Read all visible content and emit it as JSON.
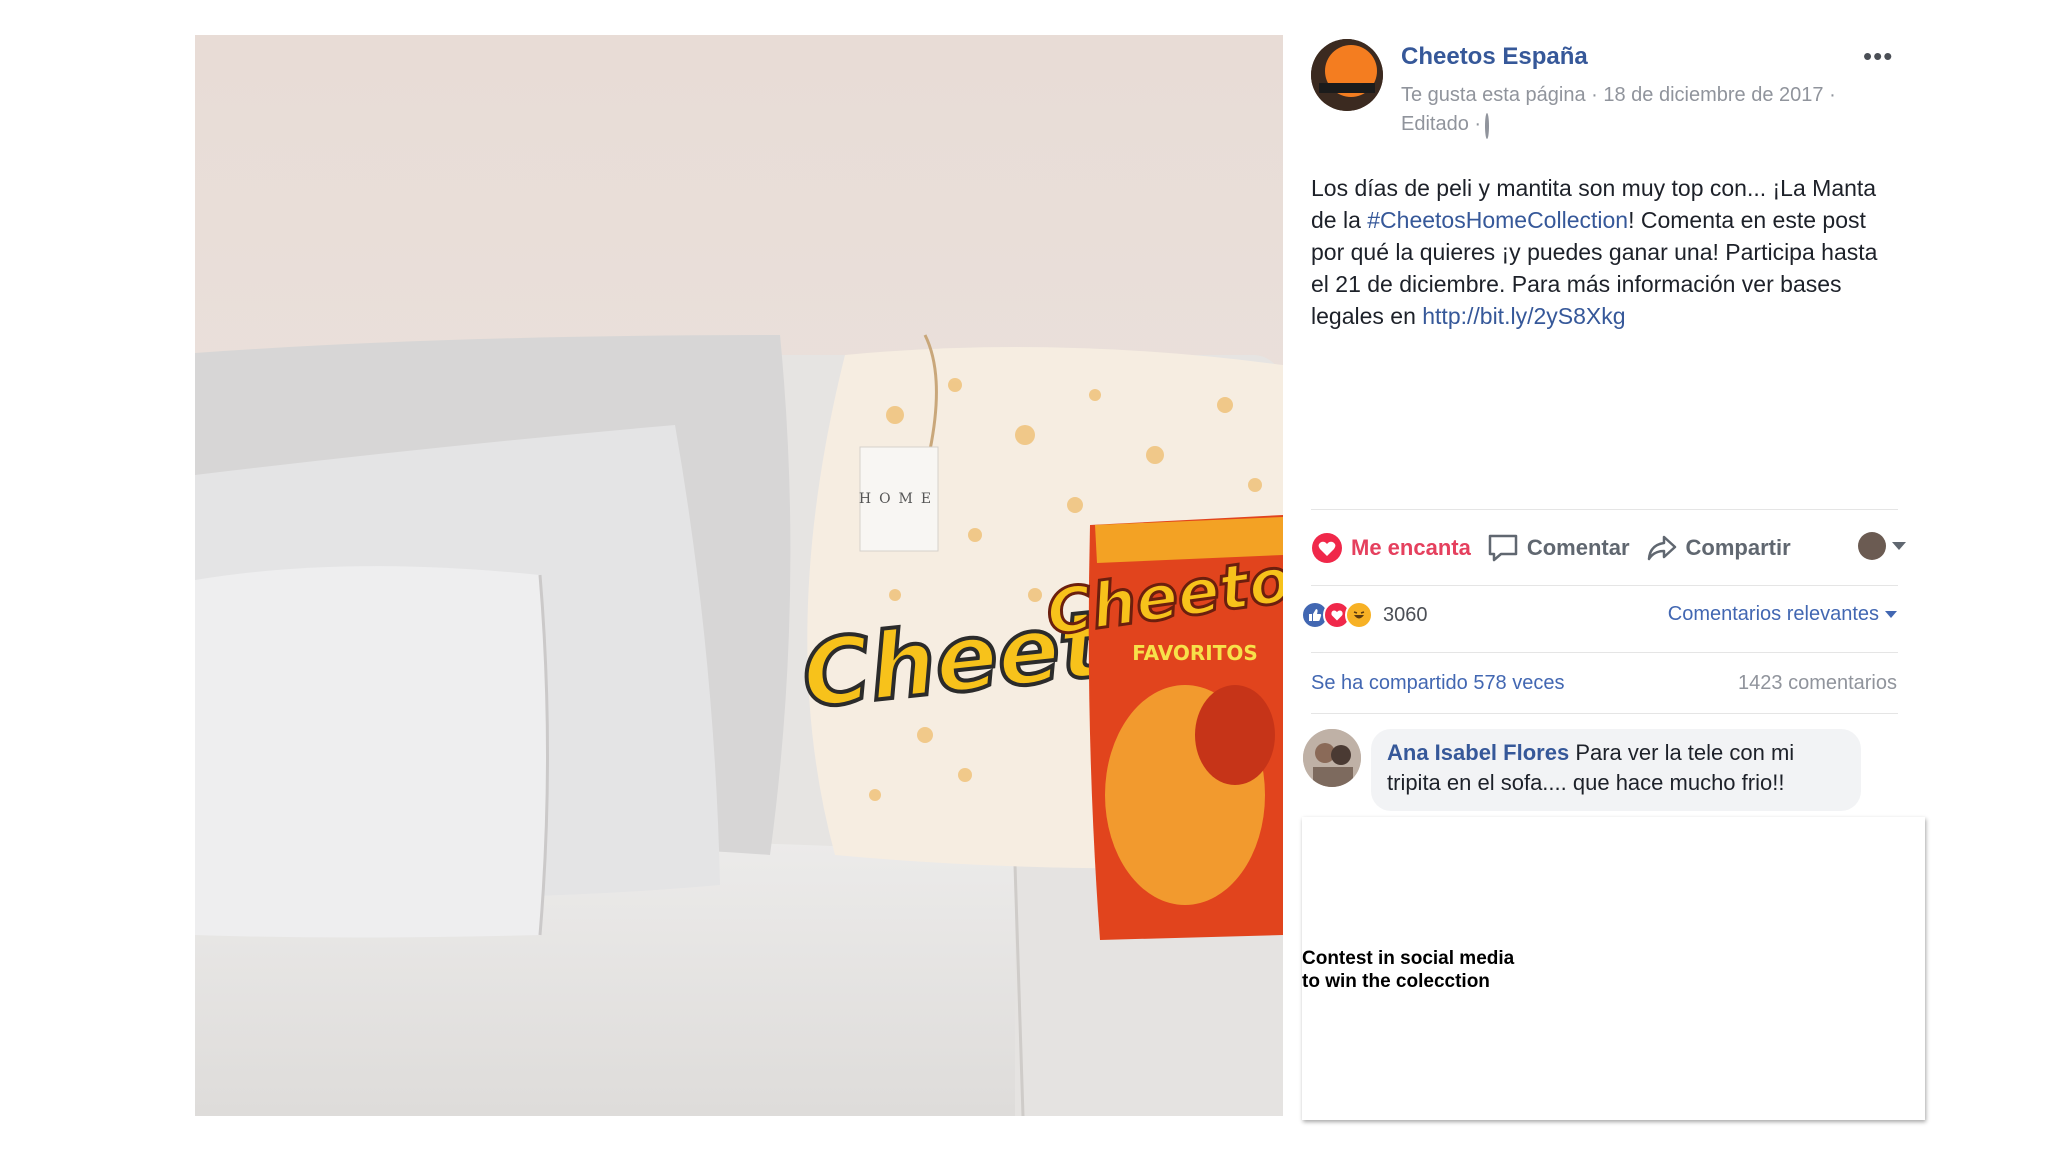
{
  "post": {
    "page_name": "Cheetos España",
    "meta_liked": "Te gusta esta página",
    "meta_date": "18 de diciembre de 2017",
    "meta_edited": "Editado",
    "text_before_hashtag": "Los días de peli y mantita son muy top con... ¡La Manta de la ",
    "hashtag": "#CheetosHomeCollection",
    "text_after_hashtag": "! Comenta en este post por qué la quieres ¡y puedes ganar una! Participa hasta el 21 de diciembre. Para más información ver bases legales en ",
    "link": "http://bit.ly/2yS8Xkg"
  },
  "actions": {
    "love_label": "Me encanta",
    "comment_label": "Comentar",
    "share_label": "Compartir"
  },
  "stats": {
    "reaction_count": "3060",
    "sort_label": "Comentarios relevantes",
    "shares": "Se ha compartido 578 veces",
    "comments": "1423 comentarios"
  },
  "comment": {
    "author": "Ana Isabel Flores",
    "text": "Para ver la tele con mi tripita en el sofa.... que hace mucho frio!!"
  },
  "annotation": {
    "line1": "Contest in social media",
    "line2": "to win the colecction"
  },
  "photo": {
    "blanket_logo": "Cheetos",
    "bag_logo": "Cheetos",
    "bag_subtitle": "FAVORITOS",
    "tag_text": "HOME"
  },
  "colors": {
    "link_blue": "#365899",
    "love_red": "#e5405e",
    "cheetos_orange": "#f05a1a",
    "cheetos_yellow": "#f7c21b"
  }
}
